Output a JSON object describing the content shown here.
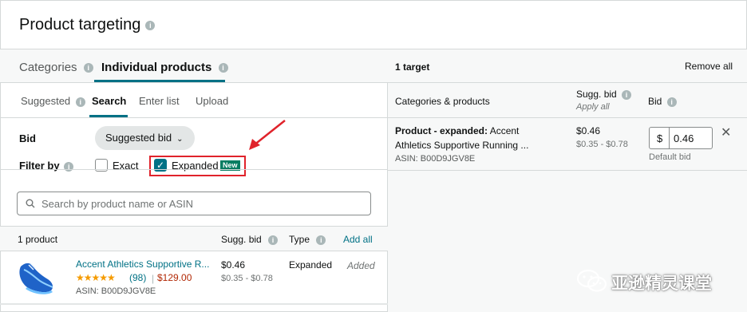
{
  "header": {
    "title": "Product targeting"
  },
  "left": {
    "tabs": [
      {
        "label": "Categories"
      },
      {
        "label": "Individual products"
      }
    ],
    "subtabs": [
      {
        "label": "Suggested"
      },
      {
        "label": "Search"
      },
      {
        "label": "Enter list"
      },
      {
        "label": "Upload"
      }
    ],
    "bid_label": "Bid",
    "bid_dropdown": "Suggested bid",
    "filter_label": "Filter by",
    "filters": [
      {
        "label": "Exact",
        "checked": false
      },
      {
        "label": "Expanded",
        "checked": true,
        "badge": "New"
      }
    ],
    "search": {
      "placeholder": "Search by product name or ASIN",
      "value": ""
    },
    "table": {
      "count": "1 product",
      "col_sugg_bid": "Sugg. bid",
      "col_type": "Type",
      "add_all": "Add all"
    },
    "product": {
      "name": "Accent Athletics Supportive R...",
      "stars": "★★★★★",
      "rating": 5,
      "reviews": "(98)",
      "price": "$129.00",
      "asin": "ASIN: B00D9JGV8E",
      "sugg_bid": "$0.46",
      "sugg_range": "$0.35 - $0.78",
      "type": "Expanded",
      "status": "Added"
    }
  },
  "right": {
    "targets": "1 target",
    "remove_all": "Remove all",
    "col_categories": "Categories & products",
    "col_sugg_bid": "Sugg. bid",
    "apply_all": "Apply all",
    "col_bid": "Bid",
    "row": {
      "title_bold": "Product - expanded:",
      "title_rest": "Accent",
      "line2": "Athletics Supportive Running ...",
      "asin": "ASIN: B00D9JGV8E",
      "sugg_bid": "$0.46",
      "sugg_range": "$0.35 - $0.78",
      "currency": "$",
      "bid_value": "0.46",
      "default_bid": "Default bid"
    }
  },
  "watermark": {
    "text": "亚逊精灵课堂"
  },
  "colors": {
    "link": "#007185",
    "highlight": "#e0232b",
    "badge": "#067d62",
    "price": "#b12704"
  },
  "icons": [
    "info-icon",
    "chevron-down-icon",
    "checkmark-icon",
    "search-icon",
    "close-icon",
    "wechat-icon",
    "star-icon"
  ]
}
